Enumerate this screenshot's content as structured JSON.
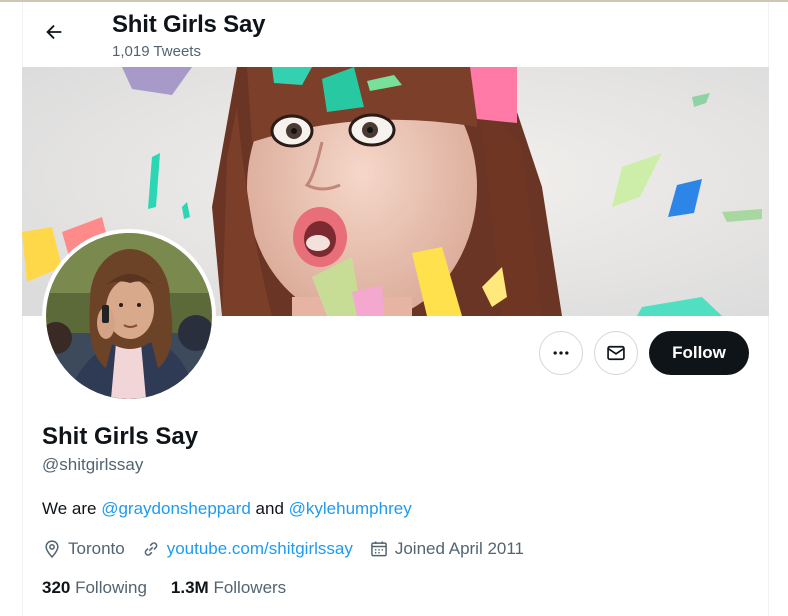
{
  "header": {
    "title": "Shit Girls Say",
    "subtitle": "1,019 Tweets"
  },
  "icons": {
    "back": "arrow-left-icon",
    "more": "more-icon",
    "message": "envelope-icon",
    "location": "location-pin-icon",
    "link": "link-icon",
    "calendar": "calendar-icon"
  },
  "actions": {
    "follow_label": "Follow"
  },
  "profile": {
    "name": "Shit Girls Say",
    "handle": "@shitgirlssay",
    "bio": {
      "prefix": "We are ",
      "mention1": "@graydonsheppard",
      "middle": " and ",
      "mention2": "@kylehumphrey"
    },
    "location": "Toronto",
    "website": "youtube.com/shitgirlssay",
    "joined": "Joined April 2011"
  },
  "stats": {
    "following_count": "320",
    "following_label": " Following",
    "followers_count": "1.3M",
    "followers_label": " Followers"
  },
  "colors": {
    "accent": "#1d9bf0",
    "text": "#0f1419",
    "secondary": "#536471",
    "border": "#cfd9de"
  }
}
